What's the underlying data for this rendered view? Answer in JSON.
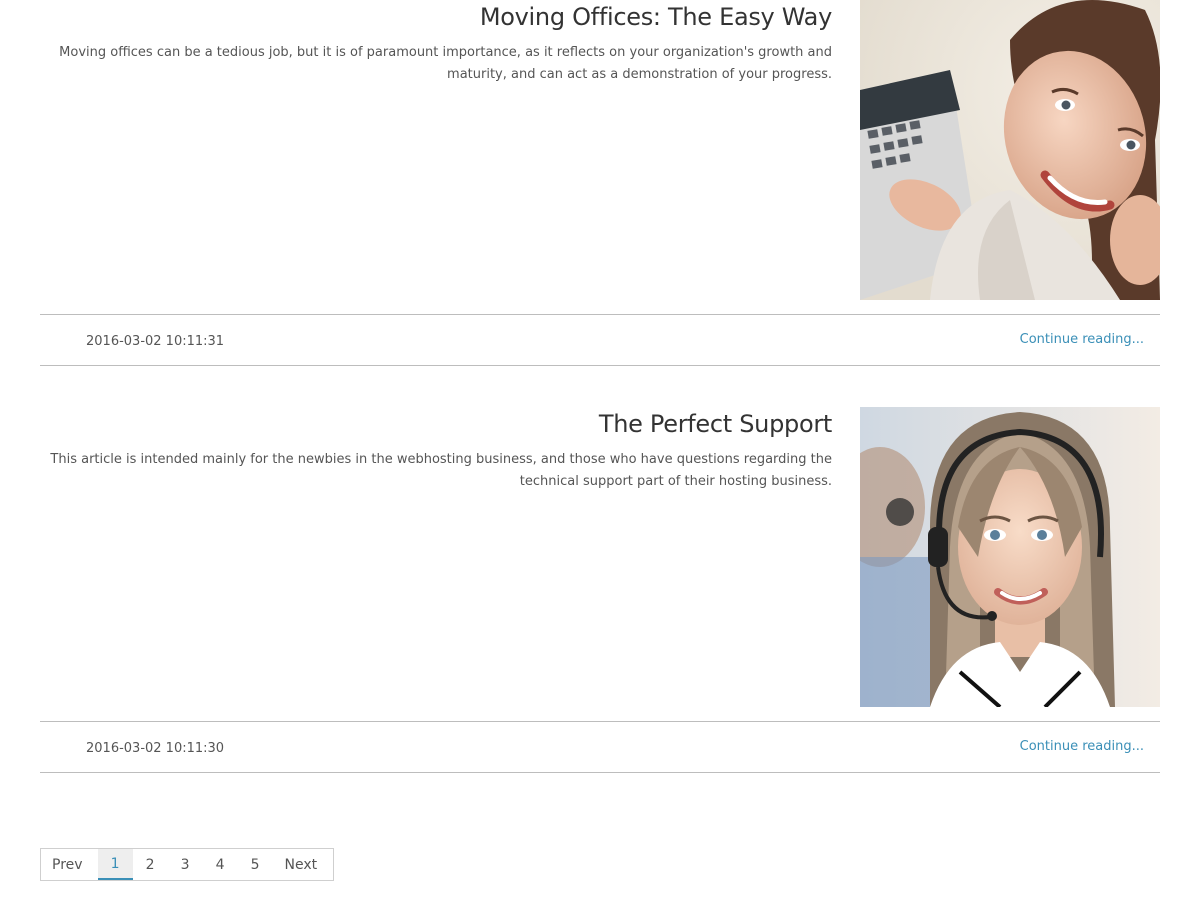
{
  "posts": [
    {
      "title": "Moving Offices: The Easy Way",
      "excerpt": "Moving offices can be a tedious job, but it is of paramount importance, as it reflects on your organization's growth and maturity, and can act as a demonstration of your progress.",
      "date": "2016-03-02 10:11:31",
      "read_more": "Continue reading..."
    },
    {
      "title": "The Perfect Support",
      "excerpt": "This article is intended mainly for the newbies in the webhosting business, and those who have questions regarding the technical support part of their hosting business.",
      "date": "2016-03-02 10:11:30",
      "read_more": "Continue reading..."
    }
  ],
  "pagination": {
    "prev": "Prev",
    "pages": [
      "1",
      "2",
      "3",
      "4",
      "5"
    ],
    "active": "1",
    "next": "Next"
  },
  "colors": {
    "link": "#3a8fb7",
    "text": "#555555",
    "title": "#333333",
    "divider": "#bdbdbd"
  }
}
